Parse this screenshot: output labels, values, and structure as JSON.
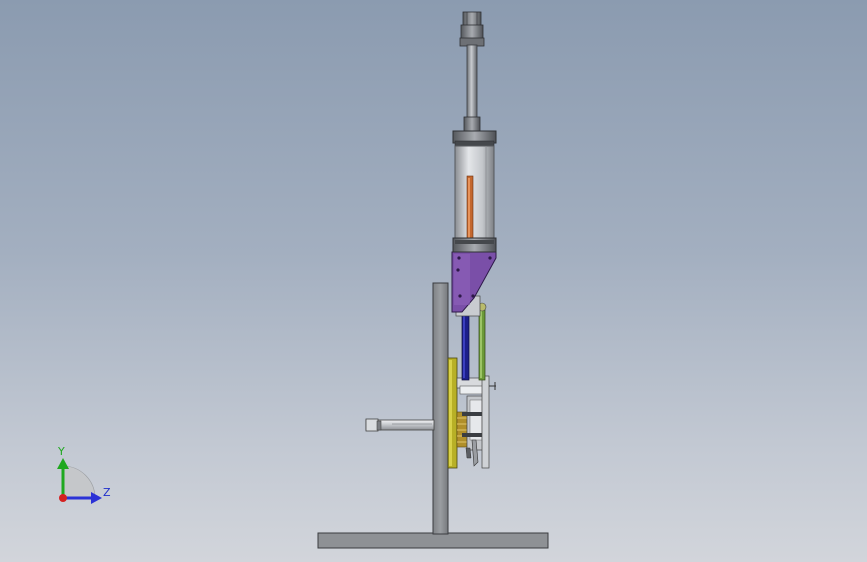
{
  "triad": {
    "y_label": "Y",
    "z_label": "Z"
  },
  "colors": {
    "y_axis": "#1fa81f",
    "z_axis": "#2b32d6",
    "x_axis": "#d42020",
    "triad_label": "#1f2fcc"
  }
}
